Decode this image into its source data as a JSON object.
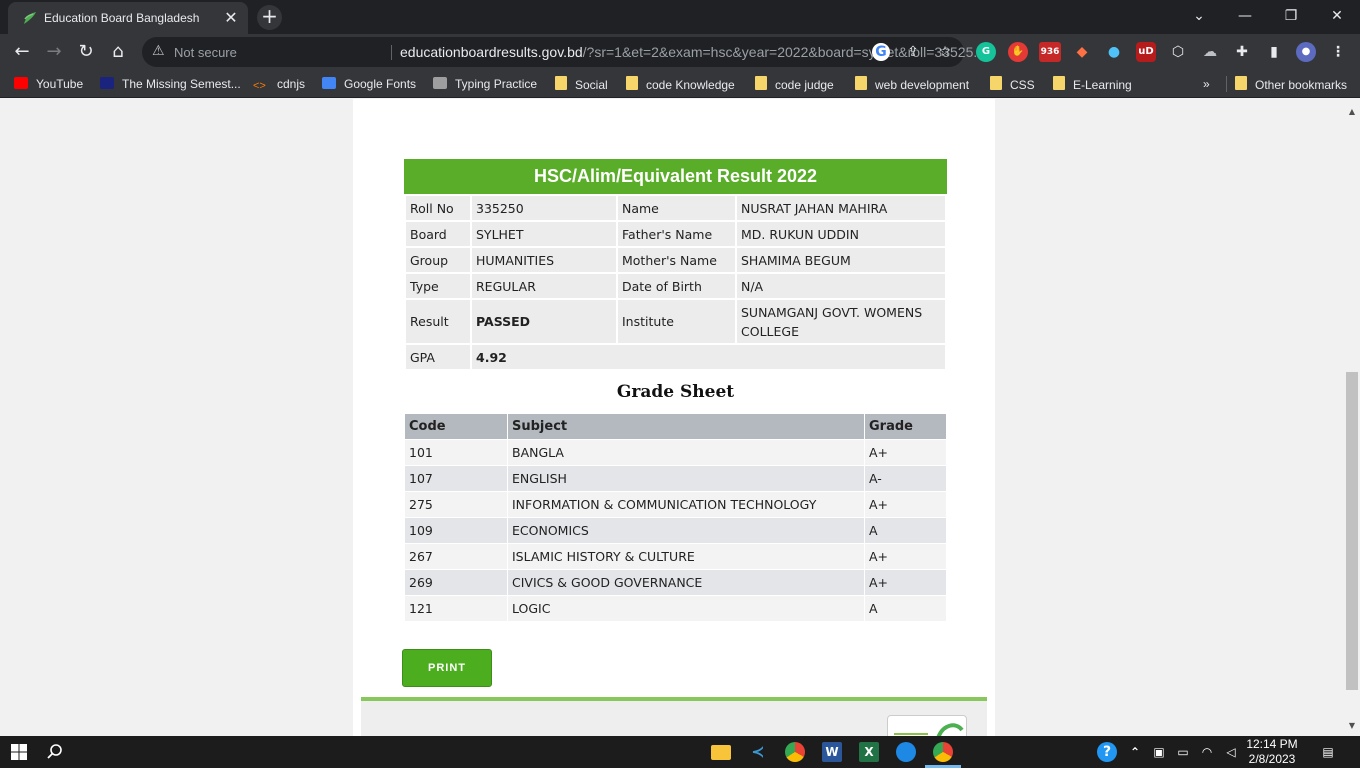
{
  "tab": {
    "title": "Education Board Bangladesh",
    "close": "✕",
    "new_tab": "+"
  },
  "window": {
    "minimize": "—",
    "restore": "❐",
    "close": "✕",
    "dropdown": "⌄"
  },
  "nav": {
    "back": "←",
    "forward": "→",
    "reload": "↻",
    "home": "⌂"
  },
  "omnibox": {
    "security_label": "Not secure",
    "url_host": "educationboardresults.gov.bd",
    "url_rest": "/?sr=1&et=2&exam=hsc&year=2022&board=sylhet&roll=33525..."
  },
  "extensions": {
    "badge_count": "936"
  },
  "bookmarks": [
    {
      "label": "YouTube",
      "icon": "youtube-icon"
    },
    {
      "label": "The Missing Semest...",
      "icon": "terminal-icon"
    },
    {
      "label": "cdnjs",
      "icon": "code-icon"
    },
    {
      "label": "Google Fonts",
      "icon": "fonts-icon"
    },
    {
      "label": "Typing Practice",
      "icon": "keyboard-icon"
    },
    {
      "label": "Social",
      "icon": "folder-icon"
    },
    {
      "label": "code Knowledge",
      "icon": "folder-icon"
    },
    {
      "label": "code judge",
      "icon": "folder-icon"
    },
    {
      "label": "web development",
      "icon": "folder-icon"
    },
    {
      "label": "CSS",
      "icon": "folder-icon"
    },
    {
      "label": "E-Learning",
      "icon": "folder-icon"
    }
  ],
  "bookmarks_overflow": "»",
  "other_bookmarks": "Other bookmarks",
  "result": {
    "heading": "HSC/Alim/Equivalent Result 2022",
    "rows": [
      {
        "l1": "Roll No",
        "v1": "335250",
        "l2": "Name",
        "v2": "NUSRAT JAHAN MAHIRA"
      },
      {
        "l1": "Board",
        "v1": "SYLHET",
        "l2": "Father's Name",
        "v2": "MD. RUKUN UDDIN"
      },
      {
        "l1": "Group",
        "v1": "HUMANITIES",
        "l2": "Mother's Name",
        "v2": "SHAMIMA BEGUM"
      },
      {
        "l1": "Type",
        "v1": "REGULAR",
        "l2": "Date of Birth",
        "v2": "N/A"
      },
      {
        "l1": "Result",
        "v1": "PASSED",
        "l2": "Institute",
        "v2": "SUNAMGANJ GOVT. WOMENS COLLEGE"
      }
    ],
    "gpa_label": "GPA",
    "gpa_value": "4.92"
  },
  "grade_sheet": {
    "title": "Grade Sheet",
    "headers": {
      "code": "Code",
      "subject": "Subject",
      "grade": "Grade"
    },
    "rows": [
      {
        "code": "101",
        "subject": "BANGLA",
        "grade": "A+"
      },
      {
        "code": "107",
        "subject": "ENGLISH",
        "grade": "A-"
      },
      {
        "code": "275",
        "subject": "INFORMATION & COMMUNICATION TECHNOLOGY",
        "grade": "A+"
      },
      {
        "code": "109",
        "subject": "ECONOMICS",
        "grade": "A"
      },
      {
        "code": "267",
        "subject": "ISLAMIC HISTORY & CULTURE",
        "grade": "A+"
      },
      {
        "code": "269",
        "subject": "CIVICS & GOOD GOVERNANCE",
        "grade": "A+"
      },
      {
        "code": "121",
        "subject": "LOGIC",
        "grade": "A"
      }
    ]
  },
  "print_label": "PRINT",
  "clock": {
    "time": "12:14 PM",
    "date": "2/8/2023"
  },
  "colors": {
    "header_green": "#5aad28",
    "button_green": "#4cae1f",
    "footer_green": "#88c75b"
  }
}
